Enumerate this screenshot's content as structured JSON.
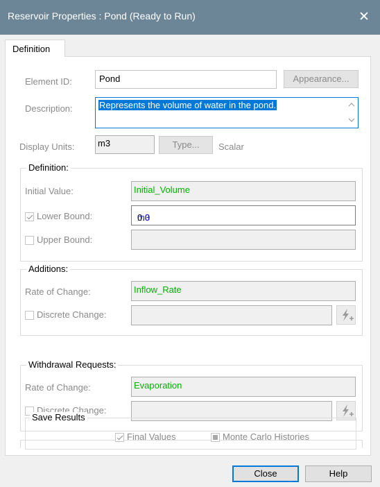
{
  "window": {
    "title": "Reservoir Properties : Pond (Ready to Run)",
    "close_glyph": "✕"
  },
  "tabs": [
    {
      "label": "Definition"
    }
  ],
  "form": {
    "element_id_label": "Element ID:",
    "element_id_value": "Pond",
    "appearance_button": "Appearance...",
    "description_label": "Description:",
    "description_value": "Represents the volume of water in the pond.",
    "display_units_label": "Display Units:",
    "display_units_value": "m3",
    "type_button": "Type...",
    "type_value": "Scalar"
  },
  "definition": {
    "title": "Definition:",
    "initial_value_label": "Initial Value:",
    "initial_value": "Initial_Volume",
    "lower_bound_label": "Lower Bound:",
    "lower_bound_checked": true,
    "lower_bound_number": "0.0",
    "lower_bound_unit": "m3",
    "upper_bound_label": "Upper Bound:",
    "upper_bound_checked": false,
    "upper_bound_value": ""
  },
  "additions": {
    "title": "Additions:",
    "rate_label": "Rate of Change:",
    "rate_value": "Inflow_Rate",
    "discrete_label": "Discrete Change:",
    "discrete_checked": false,
    "discrete_value": ""
  },
  "withdrawals": {
    "title": "Withdrawal Requests:",
    "rate_label": "Rate of Change:",
    "rate_value": "Evaporation",
    "discrete_label": "Discrete Change:",
    "discrete_checked": false,
    "discrete_value": ""
  },
  "save_results": {
    "title": "Save Results",
    "final_values_label": "Final Values",
    "final_values_checked": true,
    "monte_carlo_label": "Monte Carlo Histories",
    "monte_carlo_state": "indeterminate"
  },
  "footer": {
    "close_button": "Close",
    "help_button": "Help"
  },
  "colors": {
    "titlebar": "#6c8597",
    "link_green": "#00b000",
    "unit_blue": "#1a1acc",
    "selection": "#0078d7"
  },
  "icons": {
    "discrete_gadget": "lightning-plus-icon",
    "scroll_up": "chevron-up-icon",
    "scroll_down": "chevron-down-icon"
  }
}
